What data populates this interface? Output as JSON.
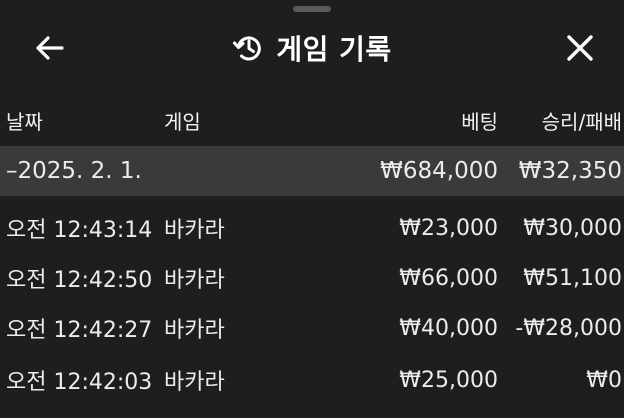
{
  "header": {
    "title": "게임 기록",
    "back_icon": "arrow-left-icon",
    "history_icon": "history-icon",
    "close_icon": "close-icon"
  },
  "columns": {
    "date": "날짜",
    "game": "게임",
    "bet": "베팅",
    "result": "승리/패배"
  },
  "summary": {
    "date": "–2025. 2. 1.",
    "bet": "₩684,000",
    "result": "₩32,350"
  },
  "rows": [
    {
      "time": "오전 12:43:14",
      "game": "바카라",
      "bet": "₩23,000",
      "result": "₩30,000"
    },
    {
      "time": "오전 12:42:50",
      "game": "바카라",
      "bet": "₩66,000",
      "result": "₩51,100"
    },
    {
      "time": "오전 12:42:27",
      "game": "바카라",
      "bet": "₩40,000",
      "result": "-₩28,000"
    },
    {
      "time": "오전 12:42:03",
      "game": "바카라",
      "bet": "₩25,000",
      "result": "₩0"
    }
  ],
  "colors": {
    "background": "#1e1e1e",
    "summary_row": "#3a3a3a",
    "text": "#ffffff"
  }
}
